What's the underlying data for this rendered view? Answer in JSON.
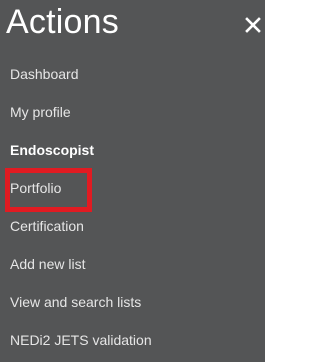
{
  "header": {
    "title": "Actions",
    "close_label": "close"
  },
  "menu": {
    "items": [
      {
        "label": "Dashboard"
      },
      {
        "label": "My profile"
      },
      {
        "label": "Endoscopist"
      },
      {
        "label": "Portfolio"
      },
      {
        "label": "Certification"
      },
      {
        "label": "Add new list"
      },
      {
        "label": "View and search lists"
      },
      {
        "label": "NEDi2 JETS validation"
      }
    ]
  },
  "colors": {
    "panel_background": "#545556",
    "text": "#e6e6e6",
    "highlight": "#e11b22"
  },
  "icons": {
    "close": "close-icon"
  }
}
